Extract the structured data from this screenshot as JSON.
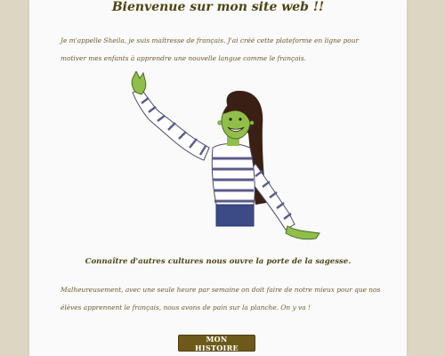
{
  "page": {
    "title": "Bienvenue sur mon site web !!",
    "intro": "Je m'appelle Sheila, je suis maîtresse de français. J'ai créé cette plateforme en ligne pour motiver mes enfants à apprendre une nouvelle langue comme le français.",
    "subtitle": "Connaître d'autres cultures nous ouvre la porte de la sagesse.",
    "body": "Malheureusement, avec une seule heure par semaine on doit faire de notre mieux pour que nos élèves apprennent le français, nous avons de pain sur la planche. On y va !",
    "cta_label": "MON HISTOIRE"
  },
  "colors": {
    "background": "#ddd6c3",
    "card": "#fafafa",
    "heading": "#4e4413",
    "text": "#6a5a2c",
    "button": "#6d5a1a"
  },
  "illustration": {
    "subject": "cartoon woman with green skin waving, striped long-sleeve top"
  }
}
